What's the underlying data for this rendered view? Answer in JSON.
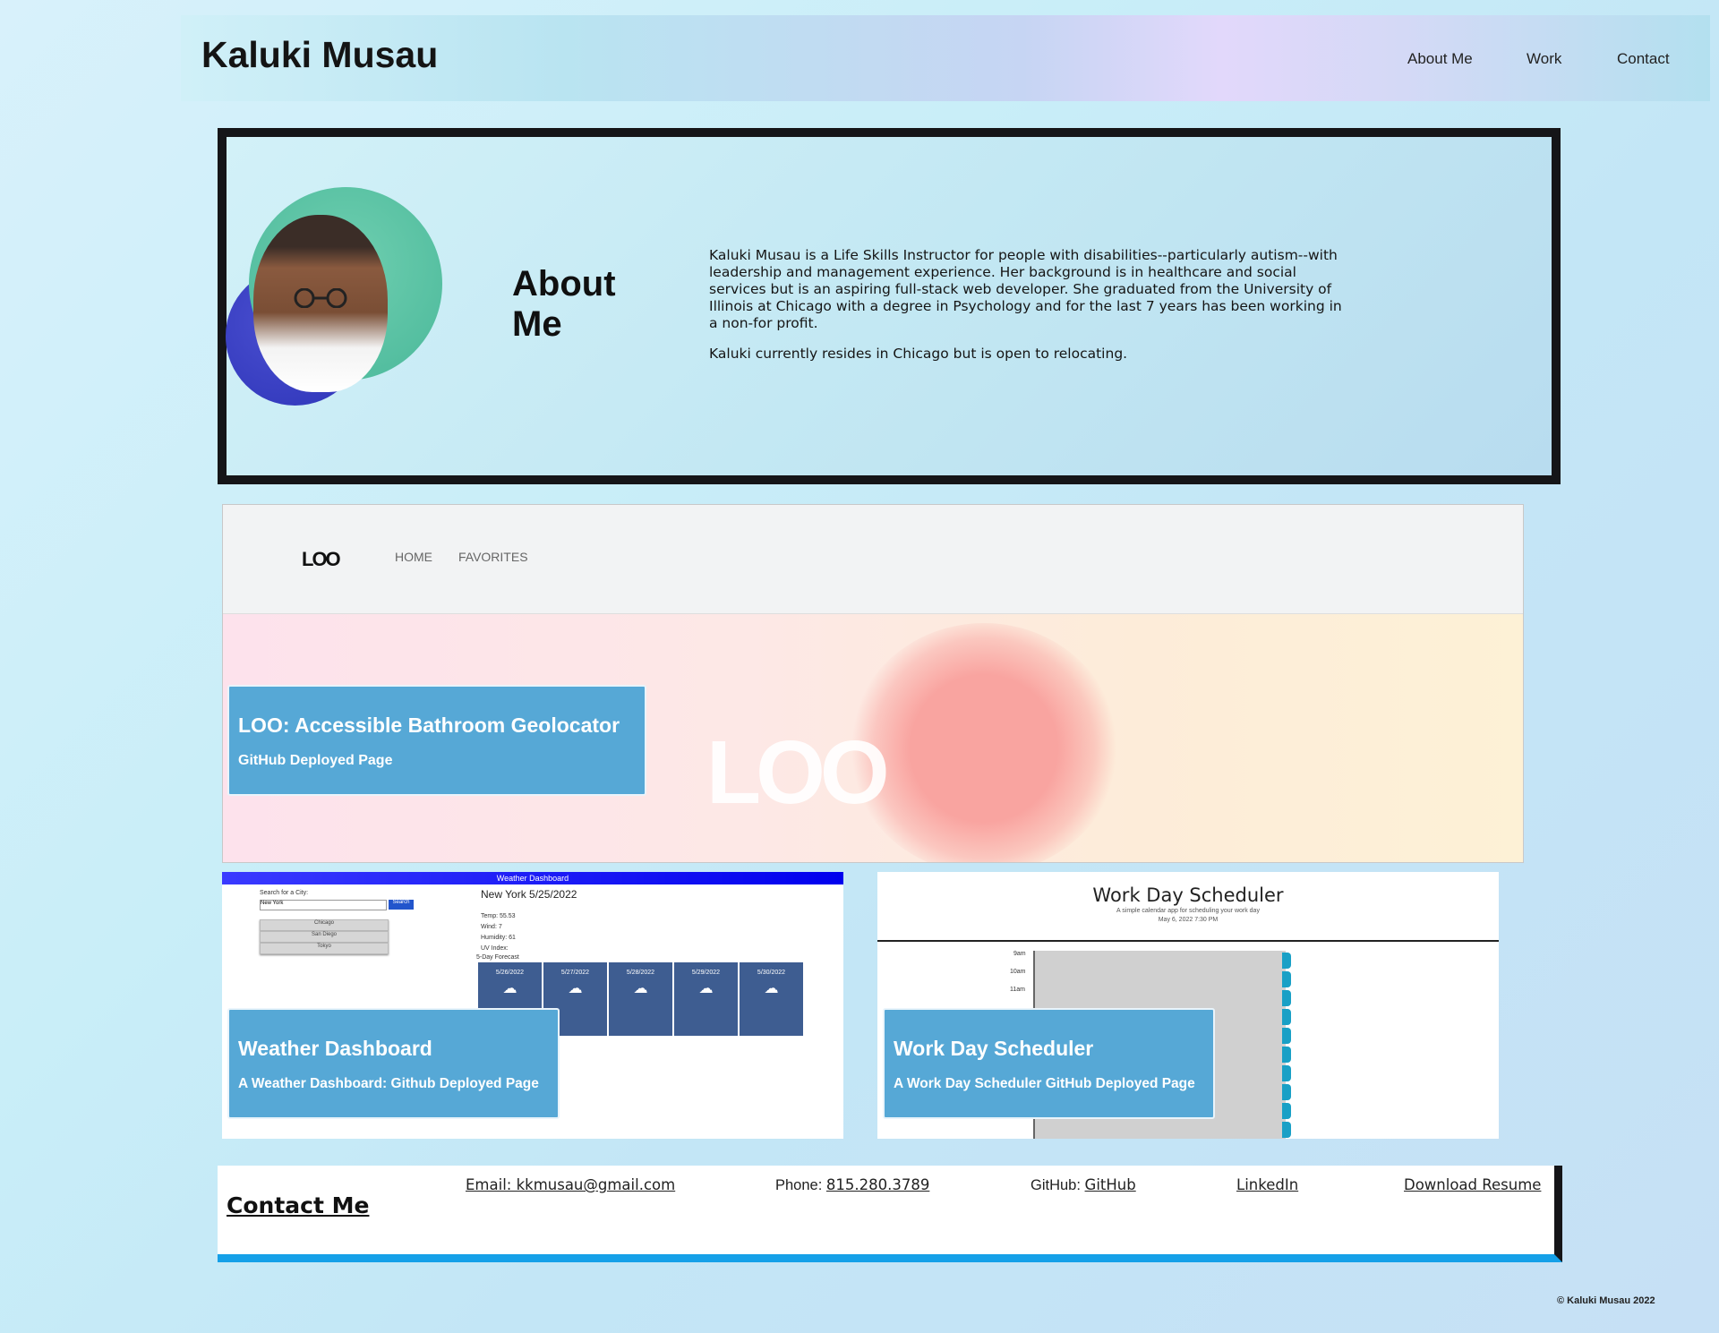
{
  "header": {
    "site_title": "Kaluki Musau",
    "nav": [
      "About Me",
      "Work",
      "Contact"
    ]
  },
  "about": {
    "heading": "About Me",
    "paragraphs": [
      "Kaluki Musau is a Life Skills Instructor for people with disabilities--particularly autism--with leadership and management experience. Her background is in healthcare and social services but is an aspiring full-stack web developer. She graduated from the University of Illinois at Chicago with a degree in Psychology and for the last 7 years has been working in a non-for profit.",
      "Kaluki currently resides in Chicago but is open to relocating."
    ]
  },
  "projects": {
    "loo": {
      "title": "LOO: Accessible Bathroom Geolocator",
      "subtitle": "GitHub Deployed Page",
      "screenshot": {
        "logo": "LOO",
        "nav": [
          "HOME",
          "FAVORITES"
        ],
        "hero_text": "LOO"
      }
    },
    "weather": {
      "title": "Weather Dashboard",
      "subtitle": "A Weather Dashboard: Github Deployed Page",
      "screenshot": {
        "bar_title": "Weather Dashboard",
        "search_label": "Search for a City:",
        "search_value": "New York",
        "search_button": "Search",
        "cities": [
          "Chicago",
          "San Diego",
          "Tokyo"
        ],
        "current": "New York 5/25/2022",
        "stats": [
          "Temp: 55.53",
          "Wind: 7",
          "Humidity: 61",
          "UV Index:"
        ],
        "forecast_label": "5-Day Forecast",
        "days": [
          "5/26/2022",
          "5/27/2022",
          "5/28/2022",
          "5/29/2022",
          "5/30/2022"
        ]
      }
    },
    "scheduler": {
      "title": "Work Day Scheduler",
      "subtitle": "A Work Day Scheduler GitHub Deployed Page",
      "screenshot": {
        "heading": "Work Day Scheduler",
        "tagline": "A simple calendar app for scheduling your work day",
        "date": "May 6, 2022 7:30 PM",
        "hours": [
          "9am",
          "10am",
          "11am"
        ]
      }
    }
  },
  "contact": {
    "heading": "Contact Me",
    "email_link": "Email: kkmusau@gmail.com",
    "phone_label": "Phone: ",
    "phone_link": "815.280.3789",
    "github_label": "GitHub: ",
    "github_link": "GitHub",
    "linkedin_link": "LinkedIn",
    "resume_link": "Download Resume"
  },
  "footer": {
    "copyright": "© Kaluki Musau 2022"
  },
  "colors": {
    "card_blue": "#56a8d6",
    "contact_accent": "#15a0e8",
    "frame_dark": "#151518"
  }
}
